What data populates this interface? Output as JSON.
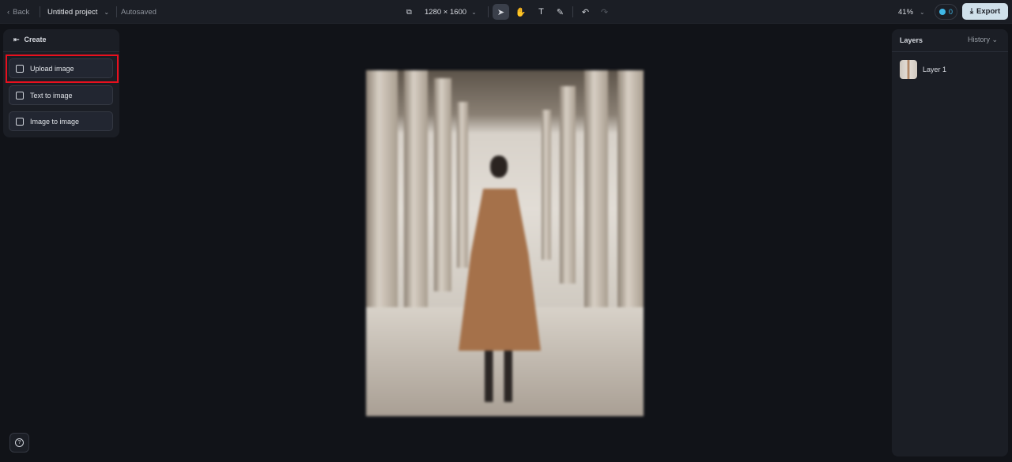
{
  "topbar": {
    "back": "Back",
    "project": "Untitled project",
    "status": "Autosaved",
    "canvas_size": "1280 × 1600",
    "zoom": "41%",
    "credits": "0",
    "export": "Export"
  },
  "left_panel": {
    "title": "Create",
    "items": [
      {
        "label": "Upload image"
      },
      {
        "label": "Text to image"
      },
      {
        "label": "Image to image"
      }
    ]
  },
  "right_panel": {
    "title": "Layers",
    "history": "History",
    "layers": [
      {
        "name": "Layer 1"
      }
    ]
  },
  "colors": {
    "highlight": "#e8101e",
    "export_bg": "#cfe0ea",
    "credit_icon": "#3fb8e8"
  }
}
